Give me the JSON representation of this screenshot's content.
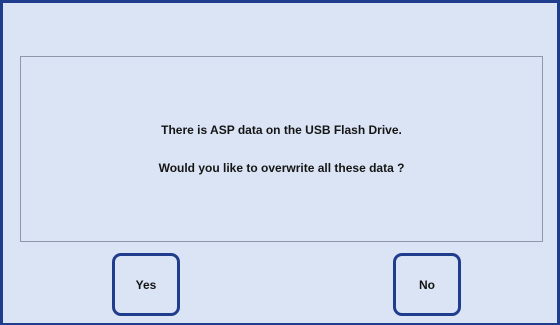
{
  "dialog": {
    "message_lines": [
      "There is ASP data on the USB Flash Drive.",
      "Would you like to overwrite all these data ?"
    ],
    "buttons": {
      "yes_label": "Yes",
      "no_label": "No"
    }
  },
  "colors": {
    "background": "#dbe4f4",
    "border": "#1f3d8c",
    "panel_border": "#8e98ad",
    "text": "#151515"
  }
}
